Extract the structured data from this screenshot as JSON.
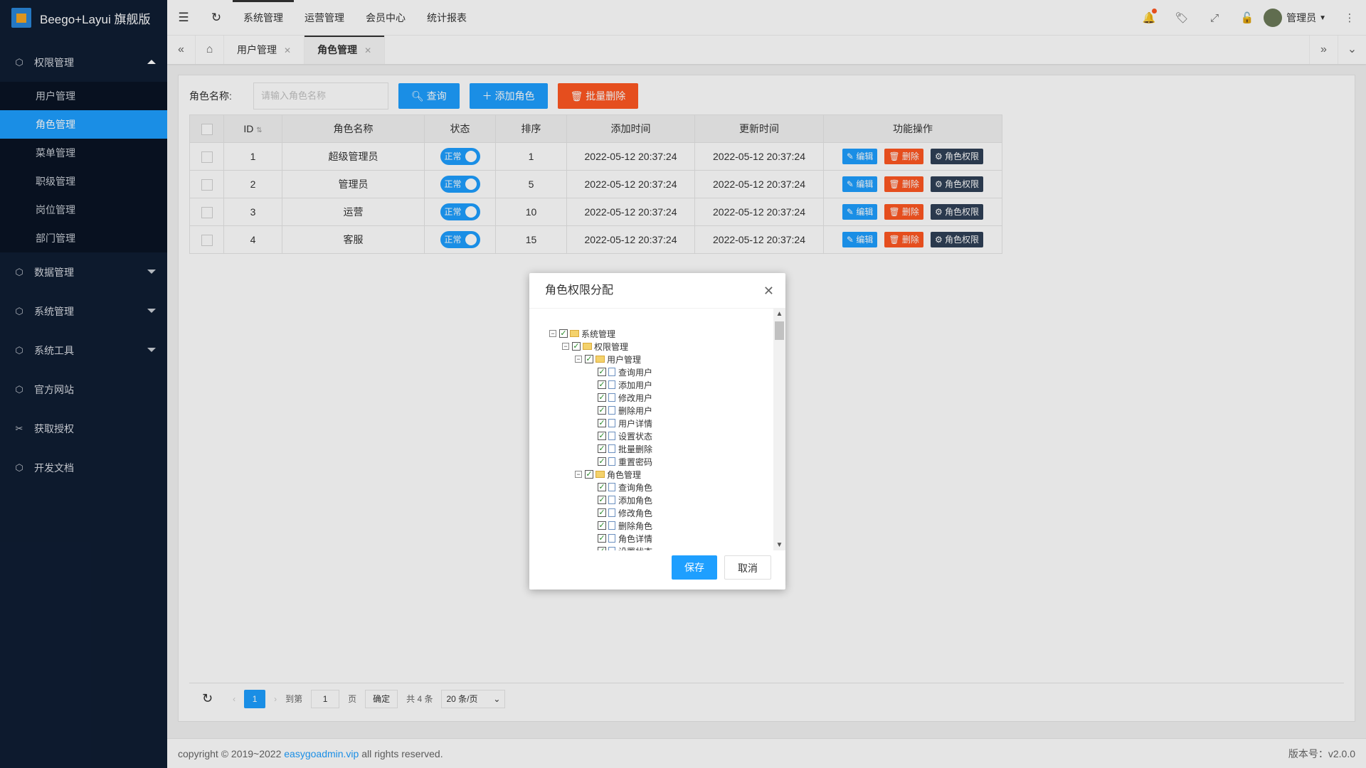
{
  "app": {
    "title": "Beego+Layui 旗舰版"
  },
  "sidebar": {
    "permission": {
      "label": "权限管理",
      "items": [
        "用户管理",
        "角色管理",
        "菜单管理",
        "职级管理",
        "岗位管理",
        "部门管理"
      ]
    },
    "groups": [
      "数据管理",
      "系统管理",
      "系统工具"
    ],
    "links": [
      "官方网站",
      "获取授权",
      "开发文档"
    ]
  },
  "header": {
    "nav": [
      "系统管理",
      "运营管理",
      "会员中心",
      "统计报表"
    ],
    "user": "管理员"
  },
  "tabs": [
    "用户管理",
    "角色管理"
  ],
  "search": {
    "label": "角色名称:",
    "placeholder": "请输入角色名称",
    "query": "查询",
    "add": "添加角色",
    "batch_delete": "批量删除"
  },
  "table": {
    "columns": [
      "ID",
      "角色名称",
      "状态",
      "排序",
      "添加时间",
      "更新时间",
      "功能操作"
    ],
    "rows": [
      {
        "id": "1",
        "name": "超级管理员",
        "status": "正常",
        "sort": "1",
        "created": "2022-05-12 20:37:24",
        "updated": "2022-05-12 20:37:24"
      },
      {
        "id": "2",
        "name": "管理员",
        "status": "正常",
        "sort": "5",
        "created": "2022-05-12 20:37:24",
        "updated": "2022-05-12 20:37:24"
      },
      {
        "id": "3",
        "name": "运营",
        "status": "正常",
        "sort": "10",
        "created": "2022-05-12 20:37:24",
        "updated": "2022-05-12 20:37:24"
      },
      {
        "id": "4",
        "name": "客服",
        "status": "正常",
        "sort": "15",
        "created": "2022-05-12 20:37:24",
        "updated": "2022-05-12 20:37:24"
      }
    ],
    "actions": {
      "edit": "编辑",
      "delete": "删除",
      "perm": "角色权限"
    }
  },
  "pager": {
    "page": "1",
    "goto": "到第",
    "goto_value": "1",
    "page_unit": "页",
    "confirm": "确定",
    "total": "共 4 条",
    "per_page": "20 条/页"
  },
  "footer": {
    "copyright_pre": "copyright © 2019~2022 ",
    "link": "easygoadmin.vip",
    "copyright_post": " all rights reserved.",
    "version": "版本号：v2.0.0"
  },
  "modal": {
    "title": "角色权限分配",
    "save": "保存",
    "cancel": "取消",
    "tree": [
      {
        "label": "系统管理",
        "level": 0,
        "type": "folder"
      },
      {
        "label": "权限管理",
        "level": 1,
        "type": "folder"
      },
      {
        "label": "用户管理",
        "level": 2,
        "type": "folder"
      },
      {
        "label": "查询用户",
        "level": 3,
        "type": "file"
      },
      {
        "label": "添加用户",
        "level": 3,
        "type": "file"
      },
      {
        "label": "修改用户",
        "level": 3,
        "type": "file"
      },
      {
        "label": "删除用户",
        "level": 3,
        "type": "file"
      },
      {
        "label": "用户详情",
        "level": 3,
        "type": "file"
      },
      {
        "label": "设置状态",
        "level": 3,
        "type": "file"
      },
      {
        "label": "批量删除",
        "level": 3,
        "type": "file"
      },
      {
        "label": "重置密码",
        "level": 3,
        "type": "file"
      },
      {
        "label": "角色管理",
        "level": 2,
        "type": "folder"
      },
      {
        "label": "查询角色",
        "level": 3,
        "type": "file"
      },
      {
        "label": "添加角色",
        "level": 3,
        "type": "file"
      },
      {
        "label": "修改角色",
        "level": 3,
        "type": "file"
      },
      {
        "label": "删除角色",
        "level": 3,
        "type": "file"
      },
      {
        "label": "角色详情",
        "level": 3,
        "type": "file"
      },
      {
        "label": "设置状态",
        "level": 3,
        "type": "file"
      }
    ]
  }
}
